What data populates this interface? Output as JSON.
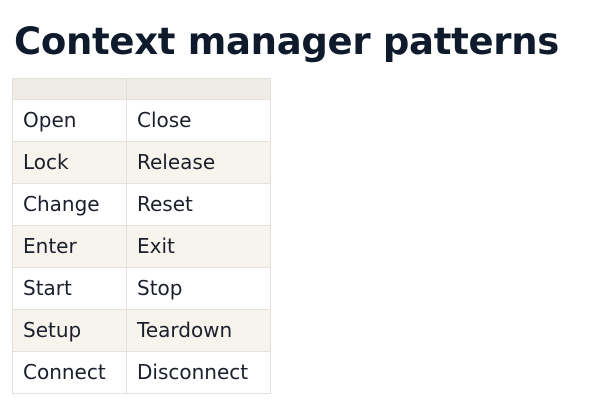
{
  "page": {
    "title": "Context manager patterns"
  },
  "table": {
    "headers": [
      "",
      ""
    ],
    "rows": [
      [
        "Open",
        "Close"
      ],
      [
        "Lock",
        "Release"
      ],
      [
        "Change",
        "Reset"
      ],
      [
        "Enter",
        "Exit"
      ],
      [
        "Start",
        "Stop"
      ],
      [
        "Setup",
        "Teardown"
      ],
      [
        "Connect",
        "Disconnect"
      ]
    ]
  },
  "colors": {
    "title_text": "#0f1b2d",
    "header_bg": "#efebe6",
    "row_alt_bg": "#f7f3ed",
    "border": "#e4e0da"
  }
}
